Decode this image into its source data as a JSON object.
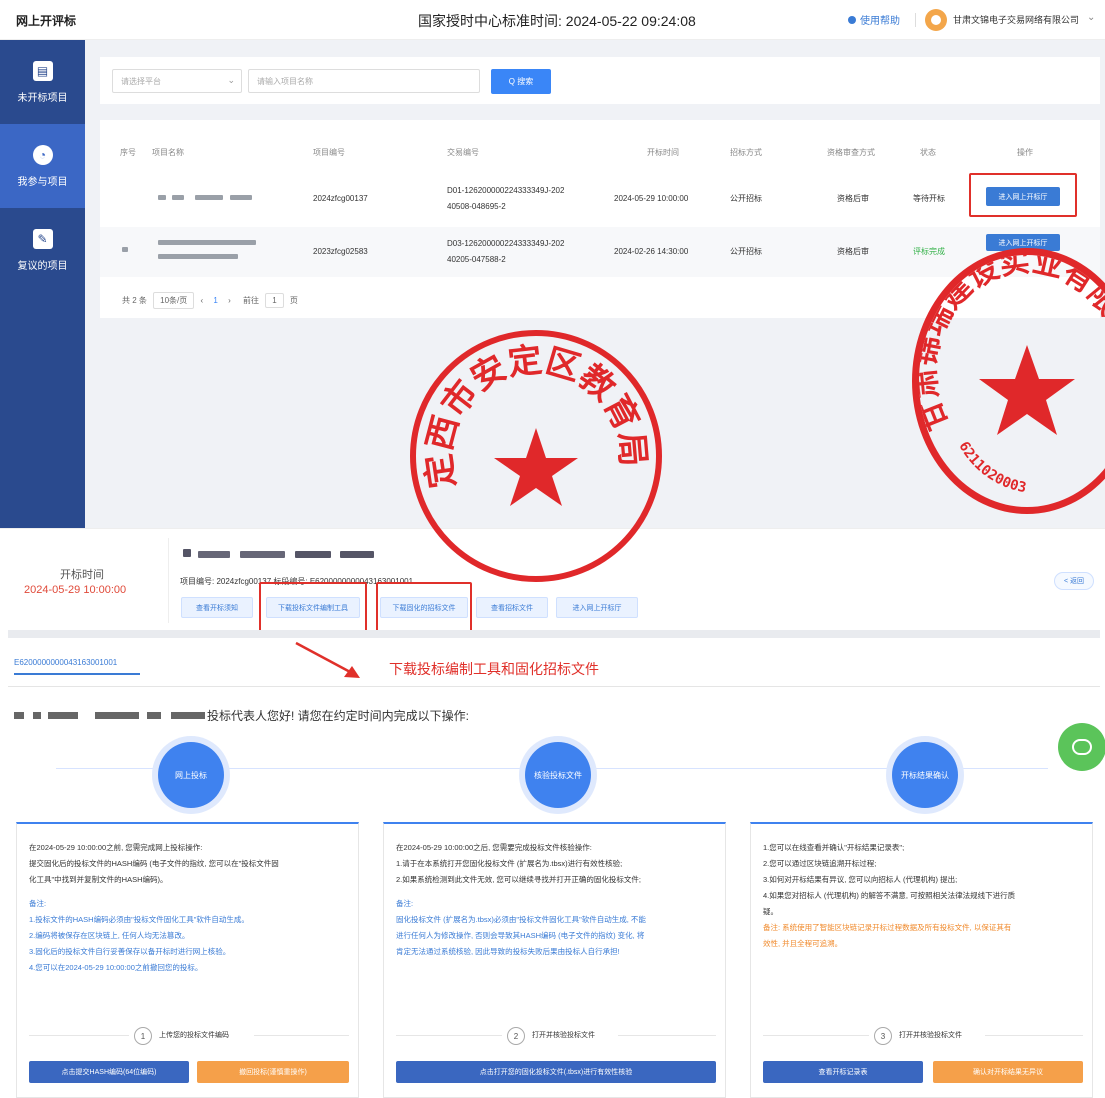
{
  "header": {
    "app_title": "网上开评标",
    "clock": "国家授时中心标准时间: 2024-05-22 09:24:08",
    "help": "使用帮助",
    "company": "甘肃文锦电子交易网络有限公司"
  },
  "sidebar": {
    "items": [
      {
        "label": "未开标项目"
      },
      {
        "label": "我参与项目"
      },
      {
        "label": "复议的项目"
      }
    ]
  },
  "search": {
    "platform_placeholder": "请选择平台",
    "name_placeholder": "请输入项目名称",
    "button": "Q 搜索"
  },
  "table": {
    "headers": [
      "序号",
      "项目名称",
      "项目编号",
      "交易编号",
      "开标时间",
      "招标方式",
      "资格审查方式",
      "状态",
      "操作"
    ],
    "rows": [
      {
        "project_no": "2024zfcg00137",
        "trade_no_1": "D01-126200000224333349J-202",
        "trade_no_2": "40508-048695-2",
        "open_time": "2024-05-29 10:00:00",
        "method": "公开招标",
        "review": "资格后审",
        "status": "等待开标",
        "action": "进入网上开标厅"
      },
      {
        "project_no": "2023zfcg02583",
        "trade_no_1": "D03-126200000224333349J-202",
        "trade_no_2": "40205-047588-2",
        "open_time": "2024-02-26 14:30:00",
        "method": "公开招标",
        "review": "资格后审",
        "status": "评标完成",
        "action": "进入网上开标厅"
      }
    ]
  },
  "pager": {
    "total": "共 2 条",
    "size": "10条/页",
    "current": "1",
    "goto": "前往",
    "goto_value": "1",
    "page_unit": "页"
  },
  "bidding": {
    "label": "开标时间",
    "time": "2024-05-29 10:00:00",
    "project_no": "项目编号: 2024zfcg00137   标段编号: E6200000000043163001001",
    "buttons": [
      "查看开标须知",
      "下载投标文件编制工具",
      "下载固化的招标文件",
      "查看招标文件",
      "进入网上开标厅"
    ],
    "back": "< 返回"
  },
  "tab": {
    "label": "E6200000000043163001001"
  },
  "annotation": "下载投标编制工具和固化招标文件",
  "greeting": "投标代表人您好! 请您在约定时间内完成以下操作:",
  "steps": [
    {
      "title": "网上投标"
    },
    {
      "title": "核验投标文件"
    },
    {
      "title": "开标结果确认"
    }
  ],
  "panels": [
    {
      "lines": [
        "在2024-05-29 10:00:00之前, 您需完成网上投标操作:",
        "提交固化后的投标文件的HASH编码 (电子文件的指纹, 您可以在\"投标文件固",
        "化工具\"中找到并复制文件的HASH编码)。"
      ],
      "notes": [
        "备注:",
        "1.投标文件的HASH编码必须由\"投标文件固化工具\"软件自动生成。",
        "2.编码将被保存在区块链上, 任何人均无法篡改。",
        "3.固化后的投标文件自行妥善保存以备开标时进行网上核验。",
        "4.您可以在2024-05-29 10:00:00之前撤回您的投标。"
      ],
      "step_no": "1",
      "step_label": "上传您的投标文件编码",
      "buttons": [
        "点击提交HASH编码(64位编码)",
        "撤回投标(谨慎重操作)"
      ]
    },
    {
      "lines": [
        "在2024-05-29 10:00:00之后, 您需要完成投标文件核验操作:",
        "1.请于在本系统打开您固化投标文件 (扩展名为.tbsx)进行有效性核验;",
        "2.如果系统检测到此文件无效, 您可以继续寻找并打开正确的固化投标文件;"
      ],
      "notes": [
        "备注:",
        "固化投标文件 (扩展名为.tbsx)必须由\"投标文件固化工具\"软件自动生成, 不能",
        "进行任何人为修改操作, 否则会导致其HASH编码 (电子文件的指纹) 变化, 将",
        "肯定无法通过系统核验, 因此导致的投标失败后果由投标人自行承担!"
      ],
      "step_no": "2",
      "step_label": "打开并核验投标文件",
      "buttons": [
        "点击打开您的固化投标文件(.tbsx)进行有效性核验"
      ]
    },
    {
      "lines": [
        "1.您可以在线查看并确认\"开标结果记录表\";",
        "2.您可以通过区块链追溯开标过程;",
        "3.如何对开标结果有异议, 您可以向招标人 (代理机构) 提出;",
        "4.如果您对招标人 (代理机构) 的解答不满意, 可按照相关法律法规线下进行质",
        "疑。"
      ],
      "warn": [
        "备注: 系统使用了智能区块链记录开标过程数据及所有投标文件, 以保证其有",
        "效性, 并且全程可追溯。"
      ],
      "step_no": "3",
      "step_label": "打开并核验投标文件",
      "buttons": [
        "查看开标记录表",
        "确认对开标结果无异议"
      ]
    }
  ],
  "seals": {
    "left_text": "定西市安定区教育局",
    "right_text": "甘肃锦瑞建设实业有限",
    "right_code": "6211020003"
  },
  "colors": {
    "sidebar": "#2a4a8e",
    "sidebar_active": "#3b67c5",
    "primary": "#3a86f7",
    "highlight_box": "#e0302a",
    "orange": "#f5a04a"
  }
}
